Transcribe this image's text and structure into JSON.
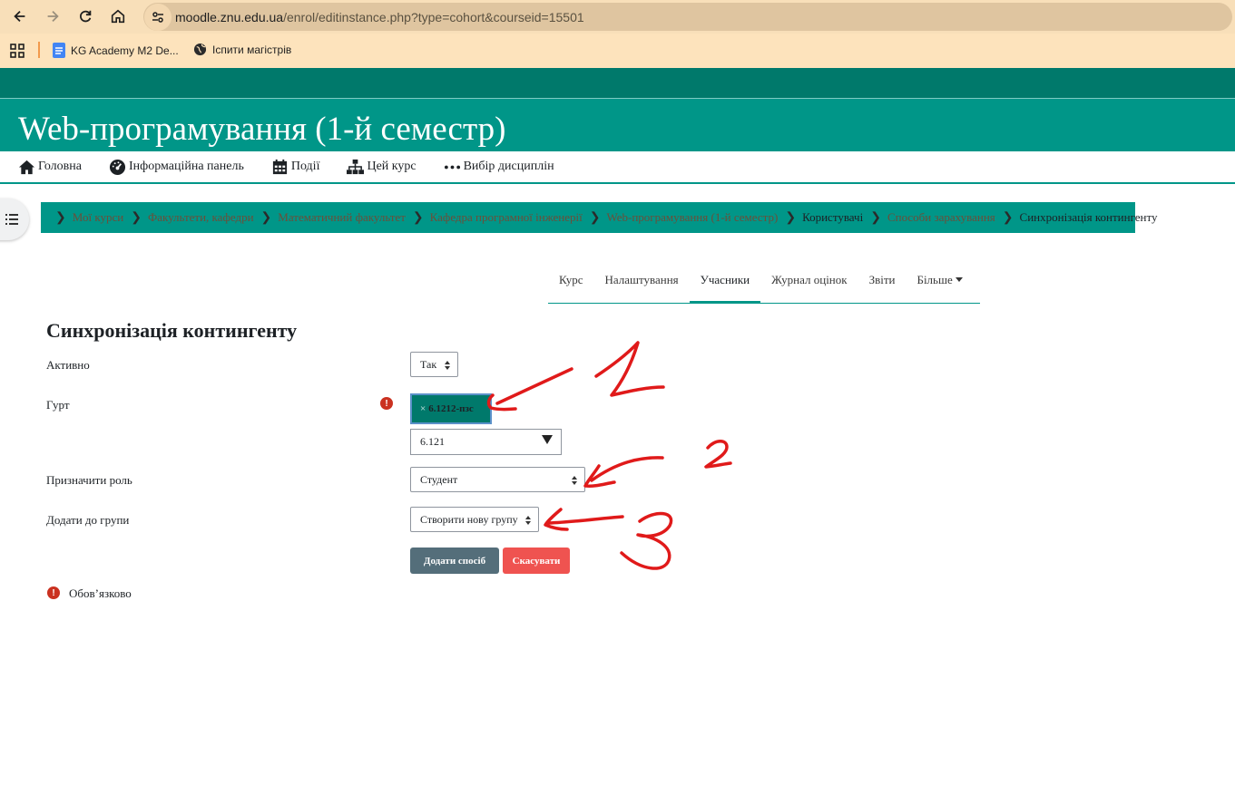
{
  "browser": {
    "url_host": "moodle.znu.edu.ua",
    "url_path": "/enrol/editinstance.php?type=cohort&courseid=15501",
    "bookmarks": [
      {
        "label": "KG Academy M2 De..."
      },
      {
        "label": "Іспити магістрів"
      }
    ]
  },
  "site": {
    "title": "Web-програмування (1-й семестр)"
  },
  "primary_nav": [
    {
      "label": "Головна",
      "icon": "home-icon"
    },
    {
      "label": "Інформаційна панель",
      "icon": "dashboard-icon"
    },
    {
      "label": "Події",
      "icon": "calendar-icon"
    },
    {
      "label": "Цей курс",
      "icon": "sitemap-icon"
    },
    {
      "label": "Вибір дисциплін",
      "icon": "ellipsis-icon"
    }
  ],
  "breadcrumb": [
    {
      "label": "Мої курси",
      "link": true
    },
    {
      "label": "Факультети, кафедри",
      "link": true
    },
    {
      "label": "Математичний факультет",
      "link": true
    },
    {
      "label": "Кафедра програмної інженерії",
      "link": true
    },
    {
      "label": "Web-програмування (1-й семестр)",
      "link": true
    },
    {
      "label": "Користувачі",
      "link": false
    },
    {
      "label": "Способи зарахування",
      "link": true
    },
    {
      "label": "Синхронізація контингенту",
      "link": false
    }
  ],
  "secondary_nav": [
    {
      "label": "Курс"
    },
    {
      "label": "Налаштування"
    },
    {
      "label": "Учасники",
      "active": true
    },
    {
      "label": "Журнал оцінок"
    },
    {
      "label": "Звіти"
    },
    {
      "label": "Більше"
    }
  ],
  "form": {
    "heading": "Синхронізація контингенту",
    "status_label": "Активно",
    "status_value": "Так",
    "cohort_label": "Гурт",
    "cohort_tag_remove": "×",
    "cohort_tag": "6.1212-пзс",
    "cohort_search": "6.121",
    "role_label": "Призначити роль",
    "role_value": "Студент",
    "group_label": "Додати до групи",
    "group_value": "Створити нову групу",
    "submit_label": "Додати спосіб",
    "cancel_label": "Скасувати",
    "required_note": "Обов’язково"
  },
  "colors": {
    "header": "#009688",
    "header_dark": "#00796b",
    "primary_button": "#546e7a",
    "cancel_button": "#ef5350",
    "required": "#ca3120",
    "annotation_ink": "#e01a1a"
  },
  "annotations": [
    {
      "label": "1"
    },
    {
      "label": "2"
    },
    {
      "label": "3"
    }
  ]
}
